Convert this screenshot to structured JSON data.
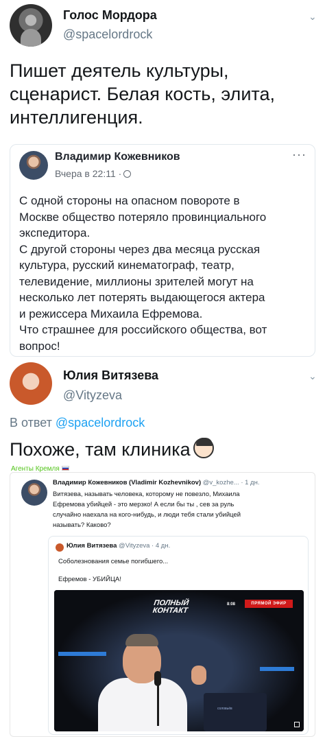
{
  "tweet": {
    "author_name": "Голос Мордора",
    "author_handle": "@spacelordrock",
    "text_lines": [
      "Пишет деятель культуры,",
      "сценарист. Белая кость, элита,",
      "интеллигенция."
    ]
  },
  "fb_post": {
    "author_name": "Владимир Кожевников",
    "time": "Вчера в 22:11 ·",
    "more": "···",
    "lines": [
      "С одной стороны на опасном повороте в",
      "Москве общество потеряло провинциального",
      "экспедитора.",
      "С другой стороны через два месяца русская",
      "культура, русский кинематограф, театр,",
      "телевидение, миллионы зрителей могут на",
      "несколько лет потерять выдающегося актера",
      "и режиссера Михаила Ефремова.",
      "Что страшнее для российского общества, вот",
      "вопрос!"
    ]
  },
  "reply": {
    "author_name": "Юлия Витязева",
    "author_handle": "@Vityzeva",
    "reply_prefix": "В ответ",
    "reply_handle": "@spacelordrock",
    "text": "Похоже, там клиника",
    "source_label": "Агенты Кремля"
  },
  "screenshot": {
    "author_name": "Владимир Кожевников (Vladimir Kozhevnikov)",
    "author_handle_time": "@v_kozhe... · 1 дн.",
    "lines": [
      "Витязева, называть человека, которому не повезло, Михаила",
      "Ефремова убийцей - это мерзко! А если бы ты , сев за руль",
      "случайно наехала на кого-нибудь, и люди тебя стали убийцей",
      "называть? Каково?"
    ],
    "quote": {
      "author_name": "Юлия Витязева",
      "author_handle_time": "@Vityzeva · 4 дн.",
      "line1": "Соболезнования семье погибшего...",
      "line2": "Ефремов - УБИЙЦА!"
    },
    "video": {
      "logo_line1": "ПОЛНЫЙ",
      "logo_line2": "КОНТАКТ",
      "time": "8:08",
      "live_badge": "ПРЯМОЙ ЭФИР",
      "laptop_label": "соловьёв"
    }
  },
  "colors": {
    "link_blue": "#1da1f2",
    "muted_gray": "#657786",
    "source_green": "#52c41a",
    "live_red": "#d11a1a"
  }
}
